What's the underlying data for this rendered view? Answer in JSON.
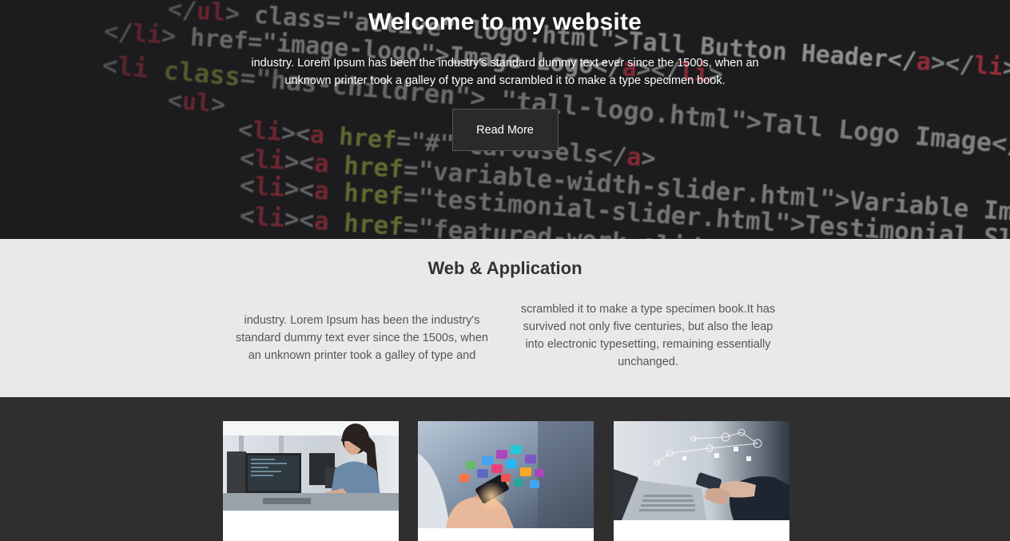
{
  "hero": {
    "title": "Welcome to my website",
    "text": "industry. Lorem Ipsum has been the industry's standard dummy text ever since the 1500s, when an unknown printer took a galley of type and scrambled it to make a type specimen book.",
    "button_label": "Read More",
    "code_lines": [
      {
        "parts": [
          [
            "t",
            "</"
          ],
          [
            "r",
            "ul"
          ],
          [
            "t",
            ">"
          ],
          [
            "w",
            "      class=\"active\"     logo.html\">Tall Button Header</"
          ],
          [
            "r",
            "a"
          ],
          [
            "t",
            "></"
          ],
          [
            "r",
            "li"
          ],
          [
            "t",
            ">"
          ]
        ]
      },
      {
        "parts": [
          [
            "t",
            "</"
          ],
          [
            "r",
            "li"
          ],
          [
            "t",
            ">"
          ],
          [
            "w",
            "          href=\"image-logo\">Image Logo</"
          ],
          [
            "r",
            "a"
          ],
          [
            "t",
            "></"
          ],
          [
            "r",
            "li"
          ],
          [
            "t",
            ">"
          ]
        ]
      },
      {
        "parts": [
          [
            "t",
            "<"
          ],
          [
            "r",
            "li"
          ],
          [
            "t",
            " "
          ],
          [
            "g",
            "class"
          ],
          [
            "t",
            "=\"has-children\">   \"tall-logo.html\">Tall Logo Image</"
          ],
          [
            "r",
            "a"
          ],
          [
            "t",
            ">"
          ]
        ]
      },
      {
        "parts": [
          [
            "t",
            "<"
          ],
          [
            "r",
            "ul"
          ],
          [
            "t",
            ">"
          ]
        ]
      },
      {
        "parts": [
          [
            "t",
            "<"
          ],
          [
            "r",
            "li"
          ],
          [
            "t",
            "><"
          ],
          [
            "r",
            "a"
          ],
          [
            "t",
            " "
          ],
          [
            "g",
            "href"
          ],
          [
            "t",
            "=\"#\">Carousels</"
          ],
          [
            "r",
            "a"
          ],
          [
            "t",
            ">"
          ]
        ]
      },
      {
        "parts": [
          [
            "t",
            "<"
          ],
          [
            "r",
            "li"
          ],
          [
            "t",
            "><"
          ],
          [
            "r",
            "a"
          ],
          [
            "t",
            " "
          ],
          [
            "g",
            "href"
          ],
          [
            "t",
            "=\"variable-width-slider.html\">Variable Image Width</"
          ],
          [
            "r",
            "a"
          ],
          [
            "t",
            ">"
          ]
        ]
      },
      {
        "parts": [
          [
            "t",
            "<"
          ],
          [
            "r",
            "li"
          ],
          [
            "t",
            "><"
          ],
          [
            "r",
            "a"
          ],
          [
            "t",
            " "
          ],
          [
            "g",
            "href"
          ],
          [
            "t",
            "=\"testimonial-slider.html\">Testimonial Slider</"
          ],
          [
            "r",
            "a"
          ],
          [
            "t",
            ">"
          ]
        ]
      },
      {
        "parts": [
          [
            "t",
            "<"
          ],
          [
            "r",
            "li"
          ],
          [
            "t",
            "><"
          ],
          [
            "r",
            "a"
          ],
          [
            "t",
            " "
          ],
          [
            "g",
            "href"
          ],
          [
            "t",
            "=\"featured-work-slider.html\">Featured Work</"
          ],
          [
            "r",
            "a"
          ],
          [
            "t",
            ">"
          ]
        ]
      }
    ]
  },
  "web": {
    "title": "Web & Application",
    "col_left": "industry. Lorem Ipsum has been the industry's standard dummy text ever since the 1500s, when an unknown printer took a galley of type and",
    "col_right": "scrambled it to make a type specimen book.It has survived not only five centuries, but also the leap into electronic typesetting, remaining essentially unchanged."
  },
  "cards": [
    {
      "image": "woman-at-computer-photo"
    },
    {
      "image": "hand-app-icons-photo"
    },
    {
      "image": "laptop-phone-network-photo"
    }
  ],
  "colors": {
    "hero_bg": "#1c1b1d",
    "section_bg": "#e9e9e9",
    "footer_bg": "#2f2f2f",
    "code_red": "#d8374b",
    "code_green": "#a6c44a"
  }
}
